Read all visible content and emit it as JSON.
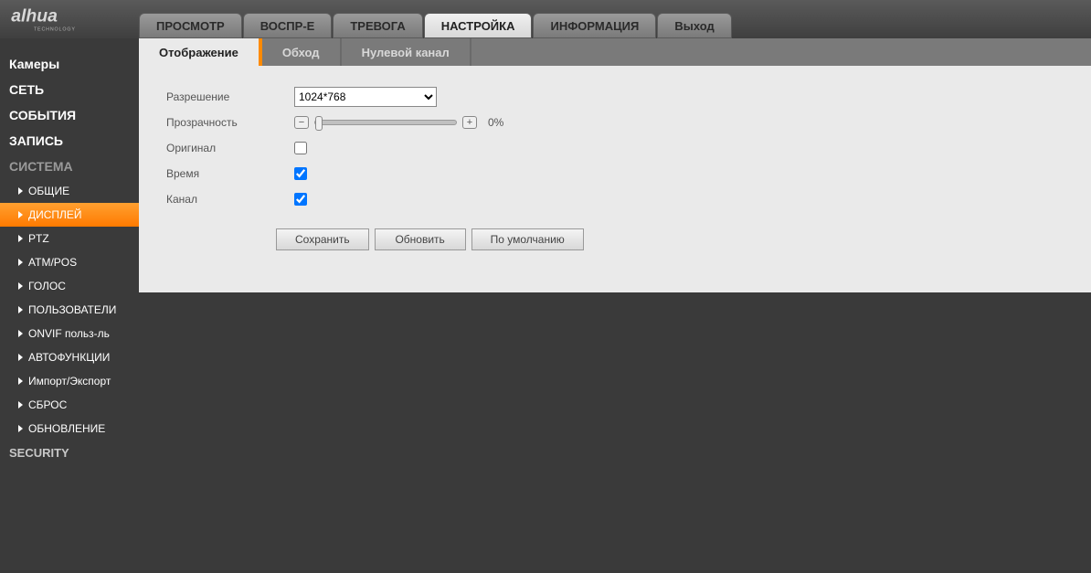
{
  "logo": {
    "brand": "alhua",
    "sub": "TECHNOLOGY"
  },
  "topnav": [
    {
      "label": "ПРОСМОТР",
      "active": false
    },
    {
      "label": "ВОСПР-Е",
      "active": false
    },
    {
      "label": "ТРЕВОГА",
      "active": false
    },
    {
      "label": "НАСТРОЙКА",
      "active": true
    },
    {
      "label": "ИНФОРМАЦИЯ",
      "active": false
    },
    {
      "label": "Выход",
      "active": false
    }
  ],
  "sidebar": {
    "cats": [
      {
        "label": "Камеры"
      },
      {
        "label": "СЕТЬ"
      },
      {
        "label": "СОБЫТИЯ"
      },
      {
        "label": "ЗАПИСЬ"
      }
    ],
    "active_cat": "СИСТЕМА",
    "subs": [
      {
        "label": "ОБЩИЕ",
        "active": false
      },
      {
        "label": "ДИСПЛЕЙ",
        "active": true
      },
      {
        "label": "PTZ",
        "active": false
      },
      {
        "label": "ATM/POS",
        "active": false
      },
      {
        "label": "ГОЛОС",
        "active": false
      },
      {
        "label": "ПОЛЬЗОВАТЕЛИ",
        "active": false
      },
      {
        "label": "ONVIF польз-ль",
        "active": false
      },
      {
        "label": "АВТОФУНКЦИИ",
        "active": false
      },
      {
        "label": "Импорт/Экспорт",
        "active": false
      },
      {
        "label": "СБРОС",
        "active": false
      },
      {
        "label": "ОБНОВЛЕНИЕ",
        "active": false
      }
    ],
    "bottom": "SECURITY"
  },
  "tabs": [
    {
      "label": "Отображение",
      "active": true
    },
    {
      "label": "Обход",
      "active": false
    },
    {
      "label": "Нулевой канал",
      "active": false
    }
  ],
  "form": {
    "resolution_label": "Разрешение",
    "resolution_value": "1024*768",
    "transparency_label": "Прозрачность",
    "transparency_value": "0%",
    "original_label": "Оригинал",
    "original_checked": false,
    "time_label": "Время",
    "time_checked": true,
    "channel_label": "Канал",
    "channel_checked": true
  },
  "buttons": {
    "save": "Сохранить",
    "refresh": "Обновить",
    "default": "По умолчанию"
  }
}
